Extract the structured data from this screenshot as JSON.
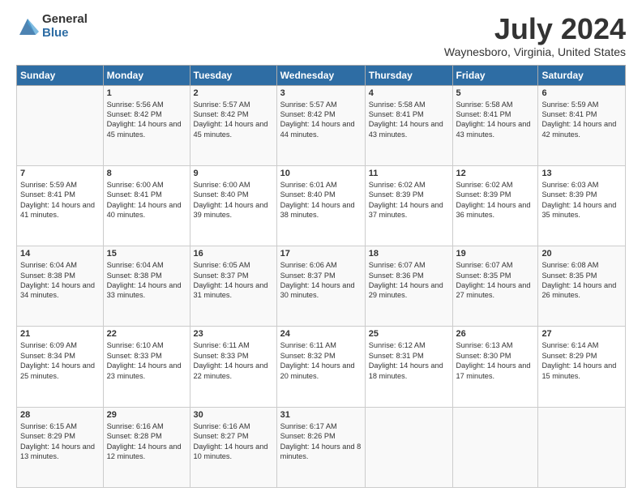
{
  "logo": {
    "general": "General",
    "blue": "Blue"
  },
  "title": "July 2024",
  "subtitle": "Waynesboro, Virginia, United States",
  "days_header": [
    "Sunday",
    "Monday",
    "Tuesday",
    "Wednesday",
    "Thursday",
    "Friday",
    "Saturday"
  ],
  "weeks": [
    [
      {
        "day": "",
        "sunrise": "",
        "sunset": "",
        "daylight": ""
      },
      {
        "day": "1",
        "sunrise": "Sunrise: 5:56 AM",
        "sunset": "Sunset: 8:42 PM",
        "daylight": "Daylight: 14 hours and 45 minutes."
      },
      {
        "day": "2",
        "sunrise": "Sunrise: 5:57 AM",
        "sunset": "Sunset: 8:42 PM",
        "daylight": "Daylight: 14 hours and 45 minutes."
      },
      {
        "day": "3",
        "sunrise": "Sunrise: 5:57 AM",
        "sunset": "Sunset: 8:42 PM",
        "daylight": "Daylight: 14 hours and 44 minutes."
      },
      {
        "day": "4",
        "sunrise": "Sunrise: 5:58 AM",
        "sunset": "Sunset: 8:41 PM",
        "daylight": "Daylight: 14 hours and 43 minutes."
      },
      {
        "day": "5",
        "sunrise": "Sunrise: 5:58 AM",
        "sunset": "Sunset: 8:41 PM",
        "daylight": "Daylight: 14 hours and 43 minutes."
      },
      {
        "day": "6",
        "sunrise": "Sunrise: 5:59 AM",
        "sunset": "Sunset: 8:41 PM",
        "daylight": "Daylight: 14 hours and 42 minutes."
      }
    ],
    [
      {
        "day": "7",
        "sunrise": "Sunrise: 5:59 AM",
        "sunset": "Sunset: 8:41 PM",
        "daylight": "Daylight: 14 hours and 41 minutes."
      },
      {
        "day": "8",
        "sunrise": "Sunrise: 6:00 AM",
        "sunset": "Sunset: 8:41 PM",
        "daylight": "Daylight: 14 hours and 40 minutes."
      },
      {
        "day": "9",
        "sunrise": "Sunrise: 6:00 AM",
        "sunset": "Sunset: 8:40 PM",
        "daylight": "Daylight: 14 hours and 39 minutes."
      },
      {
        "day": "10",
        "sunrise": "Sunrise: 6:01 AM",
        "sunset": "Sunset: 8:40 PM",
        "daylight": "Daylight: 14 hours and 38 minutes."
      },
      {
        "day": "11",
        "sunrise": "Sunrise: 6:02 AM",
        "sunset": "Sunset: 8:39 PM",
        "daylight": "Daylight: 14 hours and 37 minutes."
      },
      {
        "day": "12",
        "sunrise": "Sunrise: 6:02 AM",
        "sunset": "Sunset: 8:39 PM",
        "daylight": "Daylight: 14 hours and 36 minutes."
      },
      {
        "day": "13",
        "sunrise": "Sunrise: 6:03 AM",
        "sunset": "Sunset: 8:39 PM",
        "daylight": "Daylight: 14 hours and 35 minutes."
      }
    ],
    [
      {
        "day": "14",
        "sunrise": "Sunrise: 6:04 AM",
        "sunset": "Sunset: 8:38 PM",
        "daylight": "Daylight: 14 hours and 34 minutes."
      },
      {
        "day": "15",
        "sunrise": "Sunrise: 6:04 AM",
        "sunset": "Sunset: 8:38 PM",
        "daylight": "Daylight: 14 hours and 33 minutes."
      },
      {
        "day": "16",
        "sunrise": "Sunrise: 6:05 AM",
        "sunset": "Sunset: 8:37 PM",
        "daylight": "Daylight: 14 hours and 31 minutes."
      },
      {
        "day": "17",
        "sunrise": "Sunrise: 6:06 AM",
        "sunset": "Sunset: 8:37 PM",
        "daylight": "Daylight: 14 hours and 30 minutes."
      },
      {
        "day": "18",
        "sunrise": "Sunrise: 6:07 AM",
        "sunset": "Sunset: 8:36 PM",
        "daylight": "Daylight: 14 hours and 29 minutes."
      },
      {
        "day": "19",
        "sunrise": "Sunrise: 6:07 AM",
        "sunset": "Sunset: 8:35 PM",
        "daylight": "Daylight: 14 hours and 27 minutes."
      },
      {
        "day": "20",
        "sunrise": "Sunrise: 6:08 AM",
        "sunset": "Sunset: 8:35 PM",
        "daylight": "Daylight: 14 hours and 26 minutes."
      }
    ],
    [
      {
        "day": "21",
        "sunrise": "Sunrise: 6:09 AM",
        "sunset": "Sunset: 8:34 PM",
        "daylight": "Daylight: 14 hours and 25 minutes."
      },
      {
        "day": "22",
        "sunrise": "Sunrise: 6:10 AM",
        "sunset": "Sunset: 8:33 PM",
        "daylight": "Daylight: 14 hours and 23 minutes."
      },
      {
        "day": "23",
        "sunrise": "Sunrise: 6:11 AM",
        "sunset": "Sunset: 8:33 PM",
        "daylight": "Daylight: 14 hours and 22 minutes."
      },
      {
        "day": "24",
        "sunrise": "Sunrise: 6:11 AM",
        "sunset": "Sunset: 8:32 PM",
        "daylight": "Daylight: 14 hours and 20 minutes."
      },
      {
        "day": "25",
        "sunrise": "Sunrise: 6:12 AM",
        "sunset": "Sunset: 8:31 PM",
        "daylight": "Daylight: 14 hours and 18 minutes."
      },
      {
        "day": "26",
        "sunrise": "Sunrise: 6:13 AM",
        "sunset": "Sunset: 8:30 PM",
        "daylight": "Daylight: 14 hours and 17 minutes."
      },
      {
        "day": "27",
        "sunrise": "Sunrise: 6:14 AM",
        "sunset": "Sunset: 8:29 PM",
        "daylight": "Daylight: 14 hours and 15 minutes."
      }
    ],
    [
      {
        "day": "28",
        "sunrise": "Sunrise: 6:15 AM",
        "sunset": "Sunset: 8:29 PM",
        "daylight": "Daylight: 14 hours and 13 minutes."
      },
      {
        "day": "29",
        "sunrise": "Sunrise: 6:16 AM",
        "sunset": "Sunset: 8:28 PM",
        "daylight": "Daylight: 14 hours and 12 minutes."
      },
      {
        "day": "30",
        "sunrise": "Sunrise: 6:16 AM",
        "sunset": "Sunset: 8:27 PM",
        "daylight": "Daylight: 14 hours and 10 minutes."
      },
      {
        "day": "31",
        "sunrise": "Sunrise: 6:17 AM",
        "sunset": "Sunset: 8:26 PM",
        "daylight": "Daylight: 14 hours and 8 minutes."
      },
      {
        "day": "",
        "sunrise": "",
        "sunset": "",
        "daylight": ""
      },
      {
        "day": "",
        "sunrise": "",
        "sunset": "",
        "daylight": ""
      },
      {
        "day": "",
        "sunrise": "",
        "sunset": "",
        "daylight": ""
      }
    ]
  ]
}
